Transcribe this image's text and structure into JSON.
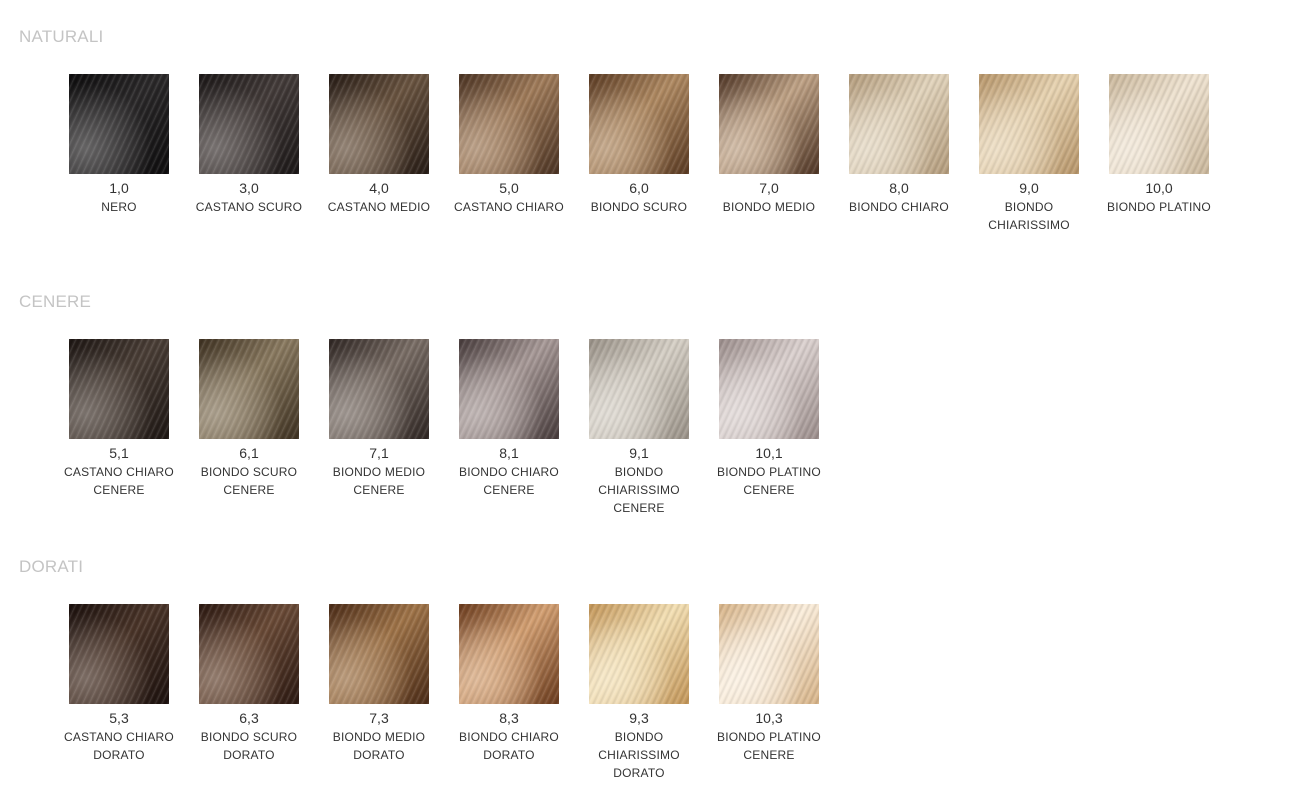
{
  "sections": [
    {
      "title": "NATURALI",
      "swatches": [
        {
          "code": "1,0",
          "name": "NERO",
          "color_a": "#0c0b0c",
          "color_b": "#2a2829"
        },
        {
          "code": "3,0",
          "name": "CASTANO SCURO",
          "color_a": "#1a1616",
          "color_b": "#433b39"
        },
        {
          "code": "4,0",
          "name": "CASTANO MEDIO",
          "color_a": "#251a14",
          "color_b": "#6a5440"
        },
        {
          "code": "5,0",
          "name": "CASTANO CHIARO",
          "color_a": "#4a3222",
          "color_b": "#a17c5a"
        },
        {
          "code": "6,0",
          "name": "BIONDO SCURO",
          "color_a": "#5a3a22",
          "color_b": "#b08a62"
        },
        {
          "code": "7,0",
          "name": "BIONDO MEDIO",
          "color_a": "#4e3424",
          "color_b": "#c0a386"
        },
        {
          "code": "8,0",
          "name": "BIONDO CHIARO",
          "color_a": "#b49c7c",
          "color_b": "#e2d4bc"
        },
        {
          "code": "9,0",
          "name": "BIONDO CHIARISSIMO",
          "color_a": "#b8966a",
          "color_b": "#e8d4b2"
        },
        {
          "code": "10,0",
          "name": "BIONDO PLATINO",
          "color_a": "#cbb89c",
          "color_b": "#f0e4d2"
        }
      ]
    },
    {
      "title": "CENERE",
      "swatches": [
        {
          "code": "5,1",
          "name": "CASTANO CHIARO CENERE",
          "color_a": "#1c1512",
          "color_b": "#4a3e36"
        },
        {
          "code": "6,1",
          "name": "BIONDO SCURO CENERE",
          "color_a": "#3d3020",
          "color_b": "#8a7a60"
        },
        {
          "code": "7,1",
          "name": "BIONDO MEDIO CENERE",
          "color_a": "#2e2522",
          "color_b": "#7a6e66"
        },
        {
          "code": "8,1",
          "name": "BIONDO CHIARO CENERE",
          "color_a": "#463a3a",
          "color_b": "#a89a98"
        },
        {
          "code": "9,1",
          "name": "BIONDO CHIARISSIMO CENERE",
          "color_a": "#9a9288",
          "color_b": "#d6d0c6"
        },
        {
          "code": "10,1",
          "name": "BIONDO PLATINO CENERE",
          "color_a": "#9c8e8c",
          "color_b": "#dcd2d0"
        }
      ]
    },
    {
      "title": "DORATI",
      "swatches": [
        {
          "code": "5,3",
          "name": "CASTANO CHIARO DORATO",
          "color_a": "#1a0f0c",
          "color_b": "#4a3428"
        },
        {
          "code": "6,3",
          "name": "BIONDO SCURO DORATO",
          "color_a": "#2a1710",
          "color_b": "#6a4a36"
        },
        {
          "code": "7,3",
          "name": "BIONDO MEDIO DORATO",
          "color_a": "#4a2a16",
          "color_b": "#a07448"
        },
        {
          "code": "8,3",
          "name": "BIONDO CHIARO DORATO",
          "color_a": "#6a3a1c",
          "color_b": "#d4a072"
        },
        {
          "code": "9,3",
          "name": "BIONDO CHIARISSIMO DORATO",
          "color_a": "#c49658",
          "color_b": "#f4e0b4"
        },
        {
          "code": "10,3",
          "name": "BIONDO PLATINO CENERE",
          "color_a": "#d8b488",
          "color_b": "#fbeedc"
        }
      ]
    }
  ]
}
